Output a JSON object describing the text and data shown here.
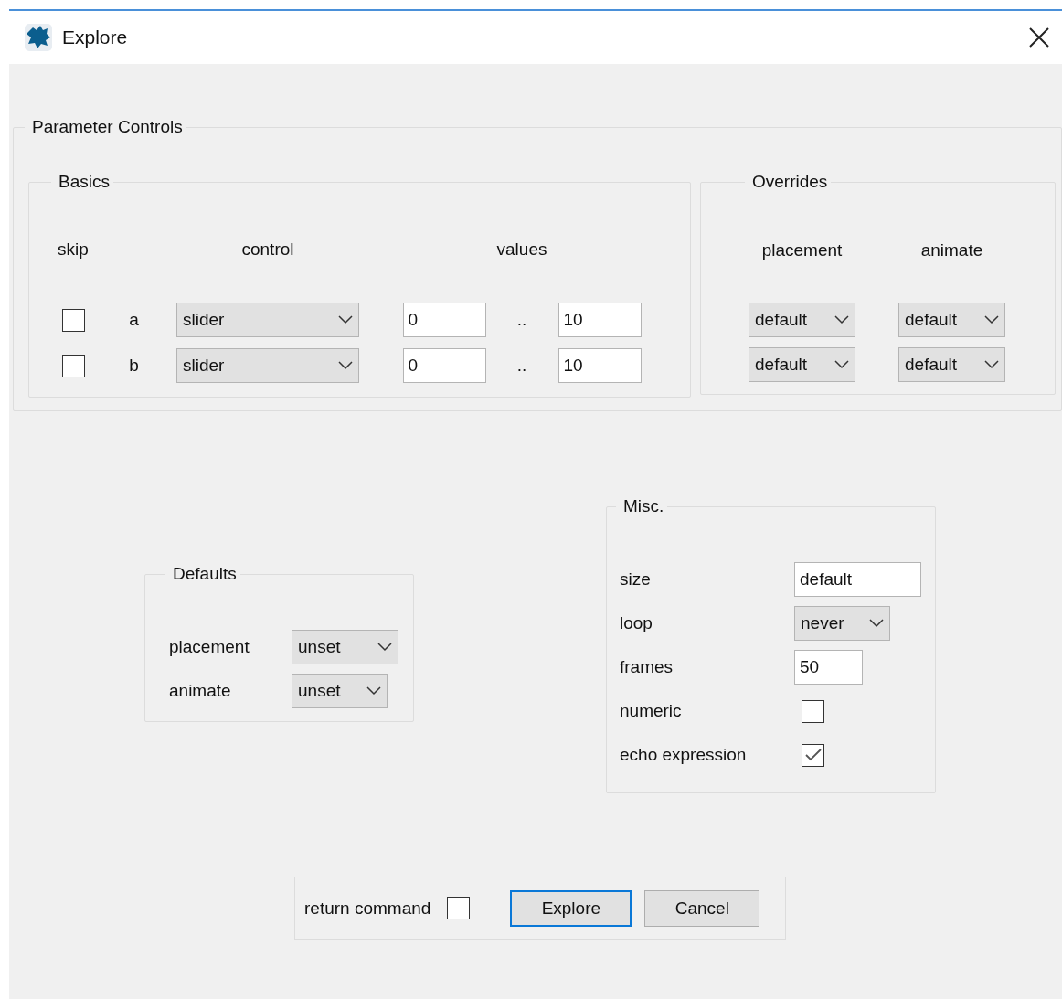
{
  "window": {
    "title": "Explore"
  },
  "parameter_controls": {
    "title": "Parameter Controls",
    "basics": {
      "title": "Basics",
      "columns": [
        "skip",
        "control",
        "values"
      ],
      "rows": [
        {
          "name": "a",
          "skip": false,
          "control": "slider",
          "min": "0",
          "separator": "..",
          "max": "10"
        },
        {
          "name": "b",
          "skip": false,
          "control": "slider",
          "min": "0",
          "separator": "..",
          "max": "10"
        }
      ]
    },
    "overrides": {
      "title": "Overrides",
      "columns": [
        "placement",
        "animate"
      ],
      "rows": [
        {
          "placement": "default",
          "animate": "default"
        },
        {
          "placement": "default",
          "animate": "default"
        }
      ]
    }
  },
  "defaults": {
    "title": "Defaults",
    "items": [
      {
        "label": "placement",
        "value": "unset"
      },
      {
        "label": "animate",
        "value": "unset"
      }
    ]
  },
  "misc": {
    "title": "Misc.",
    "items": [
      {
        "kind": "field",
        "label": "size",
        "value": "default"
      },
      {
        "kind": "dropdown",
        "label": "loop",
        "value": "never"
      },
      {
        "kind": "field",
        "label": "frames",
        "value": "50"
      },
      {
        "kind": "checkbox",
        "label": "numeric",
        "checked": false
      },
      {
        "kind": "checkbox",
        "label": "echo expression",
        "checked": true
      }
    ]
  },
  "footer": {
    "return_command": {
      "label": "return command",
      "checked": false
    },
    "buttons": [
      {
        "label": "Explore",
        "default": true
      },
      {
        "label": "Cancel",
        "default": false
      }
    ]
  }
}
